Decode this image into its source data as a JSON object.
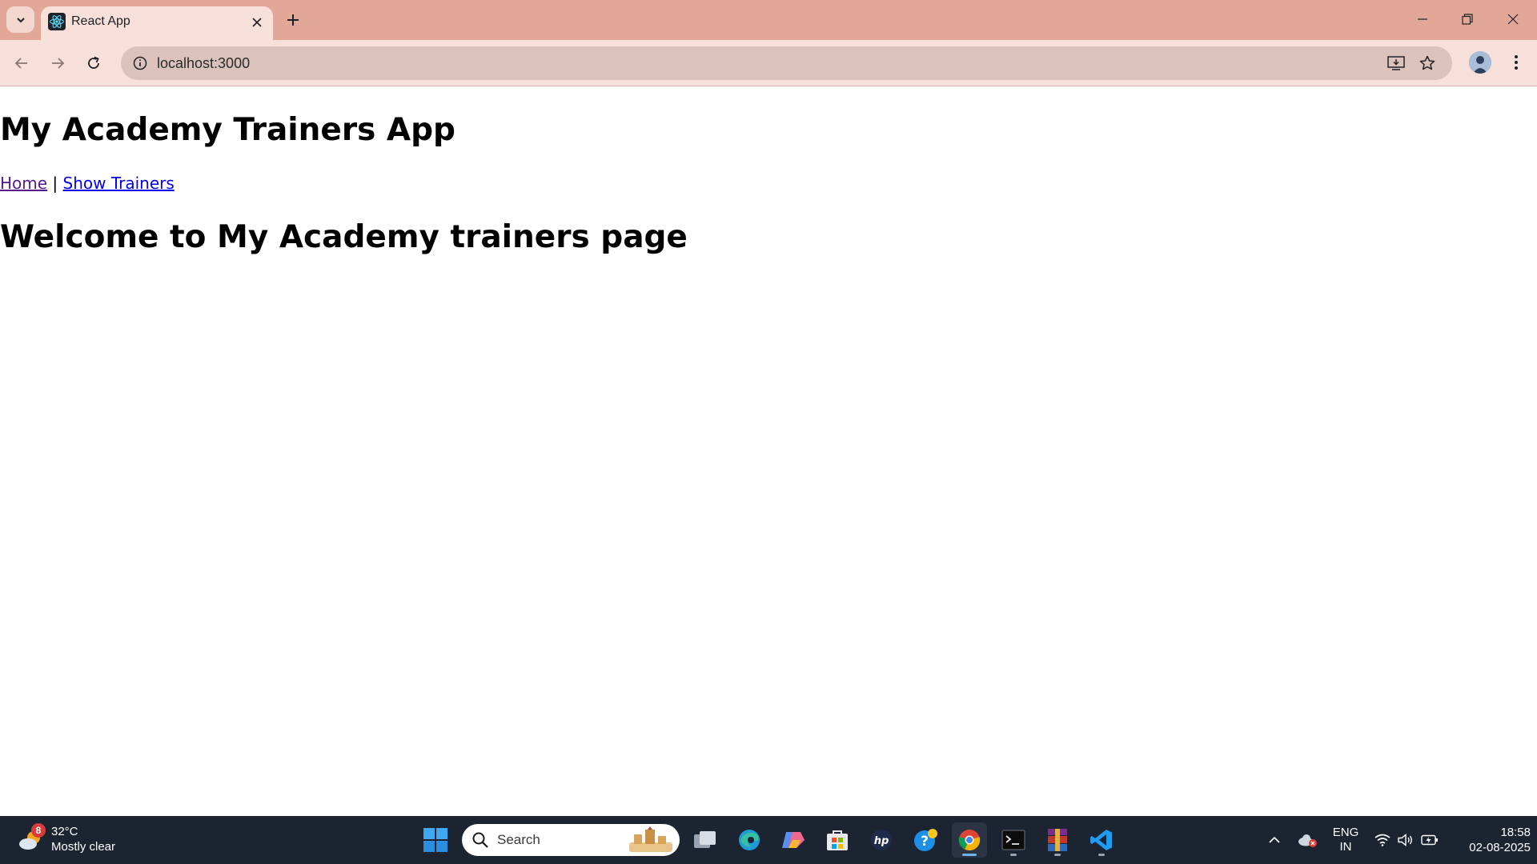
{
  "browser": {
    "tab": {
      "title": "React App"
    },
    "address_bar": {
      "url": "localhost:3000"
    }
  },
  "page": {
    "app_title": "My Academy Trainers App",
    "nav": {
      "home": "Home",
      "separator": "|",
      "show_trainers": "Show Trainers"
    },
    "welcome_heading": "Welcome to My Academy trainers page"
  },
  "taskbar": {
    "weather": {
      "badge": "8",
      "temperature": "32°C",
      "condition": "Mostly clear"
    },
    "search": {
      "placeholder": "Search"
    },
    "tray": {
      "language_line1": "ENG",
      "language_line2": "IN"
    },
    "clock": {
      "time": "18:58",
      "date": "02-08-2025"
    }
  },
  "colors": {
    "tabstrip": "#e2a797",
    "toolbar": "#f7e0da",
    "link": "#0000ee",
    "visited_link": "#551a8b",
    "taskbar": "#1c2331"
  }
}
